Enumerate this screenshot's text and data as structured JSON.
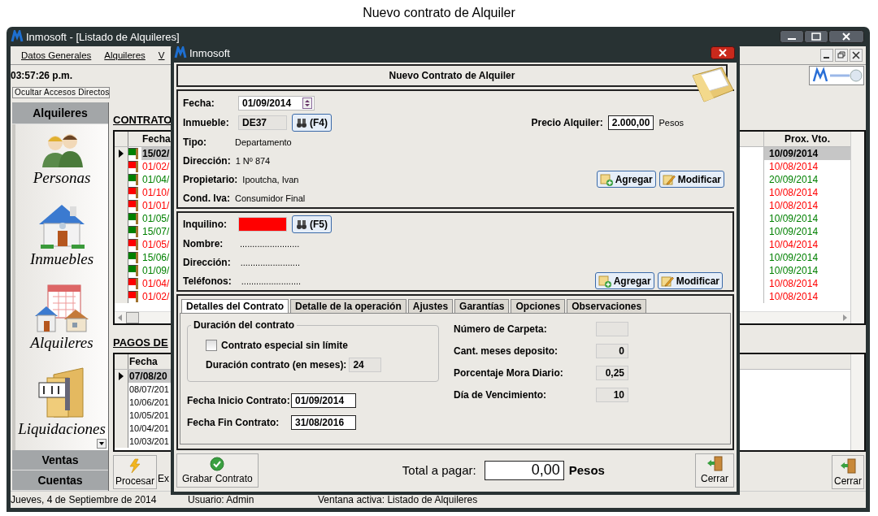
{
  "page_heading": "Nuevo contrato de Alquiler",
  "main_window": {
    "title": "Inmosoft - [Listado de Alquileres]",
    "menu": [
      "Datos Generales",
      "Alquileres",
      "V"
    ],
    "clock": "03:57:26 p.m.",
    "toggle_shortcuts_button": "Ocultar Accesos Directos",
    "sidebar": {
      "active_group": "Alquileres",
      "shortcuts": [
        {
          "label": "Personas",
          "kind": "people"
        },
        {
          "label": "Inmuebles",
          "kind": "house"
        },
        {
          "label": "Alquileres",
          "kind": "rentals"
        },
        {
          "label": "Liquidaciones",
          "kind": "money"
        }
      ],
      "other_groups": [
        "Ventas",
        "Cuentas"
      ]
    },
    "contracts": {
      "title": "CONTRATO",
      "columns": [
        "Fecha",
        "Prox. Vto."
      ],
      "rows": [
        {
          "fecha": "15/02/",
          "prox_vto": "10/09/2014",
          "color": "#008000",
          "selected": true
        },
        {
          "fecha": "01/02/",
          "prox_vto": "10/08/2014",
          "color": "#ff0000",
          "selected": false
        },
        {
          "fecha": "01/04/",
          "prox_vto": "20/09/2014",
          "color": "#008000",
          "selected": false
        },
        {
          "fecha": "01/10/",
          "prox_vto": "10/08/2014",
          "color": "#ff0000",
          "selected": false
        },
        {
          "fecha": "01/01/",
          "prox_vto": "10/08/2014",
          "color": "#ff0000",
          "selected": false
        },
        {
          "fecha": "01/05/",
          "prox_vto": "10/09/2014",
          "color": "#008000",
          "selected": false
        },
        {
          "fecha": "15/07/",
          "prox_vto": "10/09/2014",
          "color": "#008000",
          "selected": false
        },
        {
          "fecha": "01/05/",
          "prox_vto": "10/04/2014",
          "color": "#ff0000",
          "selected": false
        },
        {
          "fecha": "15/06/",
          "prox_vto": "10/09/2014",
          "color": "#008000",
          "selected": false
        },
        {
          "fecha": "01/09/",
          "prox_vto": "10/09/2014",
          "color": "#008000",
          "selected": false
        },
        {
          "fecha": "01/04/",
          "prox_vto": "10/08/2014",
          "color": "#ff0000",
          "selected": false
        },
        {
          "fecha": "01/02/",
          "prox_vto": "10/08/2014",
          "color": "#ff0000",
          "selected": false
        }
      ]
    },
    "payments": {
      "title": "PAGOS DE",
      "columns": [
        "Fecha"
      ],
      "rows": [
        {
          "fecha": "07/08/20",
          "selected": true
        },
        {
          "fecha": "08/07/201",
          "selected": false
        },
        {
          "fecha": "10/06/201",
          "selected": false
        },
        {
          "fecha": "10/05/201",
          "selected": false
        },
        {
          "fecha": "10/04/201",
          "selected": false
        },
        {
          "fecha": "10/03/201",
          "selected": false
        }
      ]
    },
    "actions": [
      "Procesar",
      "Ex"
    ],
    "close_button": "Cerrar",
    "status_bar": [
      "Jueves, 4 de Septiembre de 2014",
      "Usuario: Admin",
      "Ventana activa: Listado de Alquileres"
    ]
  },
  "dialog": {
    "title": "Inmosoft",
    "heading": "Nuevo Contrato de Alquiler",
    "property": {
      "fecha_label": "Fecha:",
      "fecha": "01/09/2014",
      "inmueble_label": "Inmueble:",
      "inmueble": "DE37",
      "lookup_button": "(F4)",
      "precio_label": "Precio Alquiler:",
      "precio": "2.000,00",
      "precio_unit": "Pesos",
      "details": [
        {
          "label": "Tipo:",
          "value": "Departamento"
        },
        {
          "label": "Dirección:",
          "value": "1 Nº 874"
        },
        {
          "label": "Propietario:",
          "value": "Ipoutcha, Ivan"
        },
        {
          "label": "Cond. Iva:",
          "value": "Consumidor Final"
        }
      ],
      "buttons": [
        "Agregar",
        "Modificar"
      ]
    },
    "tenant": {
      "inquilino_label": "Inquilino:",
      "inquilino_invalid": true,
      "lookup_button": "(F5)",
      "details": [
        {
          "label": "Nombre:",
          "value": "........................"
        },
        {
          "label": "Dirección:",
          "value": "........................"
        },
        {
          "label": "Teléfonos:",
          "value": "........................"
        }
      ],
      "buttons": [
        "Agregar",
        "Modificar"
      ]
    },
    "tabs": [
      {
        "label": "Detalles del Contrato",
        "selected": true
      },
      {
        "label": "Detalle de la operación",
        "selected": false
      },
      {
        "label": "Ajustes",
        "selected": false
      },
      {
        "label": "Garantías",
        "selected": false
      },
      {
        "label": "Opciones",
        "selected": false
      },
      {
        "label": "Observaciones",
        "selected": false
      }
    ],
    "duration": {
      "title": "Duración del contrato",
      "unlimited_label": "Contrato especial sin límite",
      "unlimited_checked": false,
      "months_label": "Duración contrato (en meses):",
      "months": "24"
    },
    "dates": [
      {
        "label": "Fecha Inicio Contrato:",
        "value": "01/09/2014"
      },
      {
        "label": "Fecha Fin Contrato:",
        "value": "31/08/2016"
      }
    ],
    "settings": [
      {
        "label": "Número de Carpeta:"
      },
      {
        "label": "Cant. meses deposito:",
        "value": "0"
      },
      {
        "label": "Porcentaje Mora Diario:",
        "value": "0,25"
      },
      {
        "label": "Día de Vencimiento:",
        "value": "10"
      }
    ],
    "save_button": "Grabar Contrato",
    "total_label": "Total a pagar:",
    "total": "0,00",
    "total_unit": "Pesos",
    "close_button": "Cerrar"
  }
}
